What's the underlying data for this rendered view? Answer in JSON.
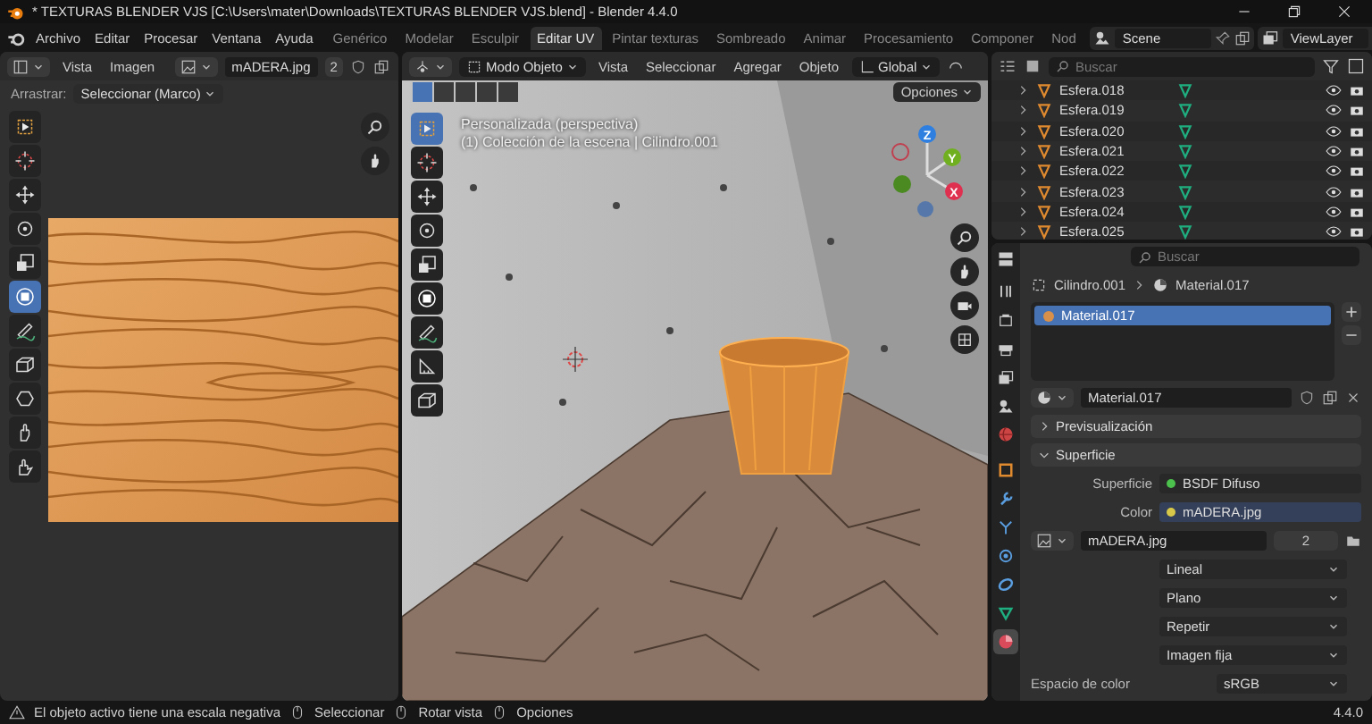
{
  "window": {
    "title": "* TEXTURAS BLENDER VJS [C:\\Users\\mater\\Downloads\\TEXTURAS BLENDER VJS.blend] - Blender 4.4.0"
  },
  "menu": [
    "Archivo",
    "Editar",
    "Procesar",
    "Ventana",
    "Ayuda"
  ],
  "workspaces": [
    {
      "label": "Genérico",
      "selected": false
    },
    {
      "label": "Modelar",
      "selected": false
    },
    {
      "label": "Esculpir",
      "selected": false
    },
    {
      "label": "Editar UV",
      "selected": true
    },
    {
      "label": "Pintar texturas",
      "selected": false
    },
    {
      "label": "Sombreado",
      "selected": false
    },
    {
      "label": "Animar",
      "selected": false
    },
    {
      "label": "Procesamiento",
      "selected": false
    },
    {
      "label": "Componer",
      "selected": false
    },
    {
      "label": "Nod",
      "selected": false
    }
  ],
  "scene": "Scene",
  "view_layer": "ViewLayer",
  "uv_editor": {
    "menu": [
      "Vista",
      "Imagen"
    ],
    "image": "mADERA.jpg",
    "users": "2",
    "drag_label": "Arrastrar:",
    "drag_mode": "Seleccionar (Marco)",
    "tools": [
      {
        "kind": "select",
        "selected": false
      },
      {
        "kind": "cursor",
        "selected": false
      },
      {
        "kind": "move",
        "selected": false
      },
      {
        "kind": "rotate",
        "selected": false
      },
      {
        "kind": "scale",
        "selected": false
      },
      {
        "kind": "transform",
        "selected": true
      },
      {
        "kind": "annotate",
        "selected": false
      },
      {
        "kind": "box",
        "selected": false
      },
      {
        "kind": "rip",
        "selected": false
      },
      {
        "kind": "grab",
        "selected": false
      },
      {
        "kind": "relax",
        "selected": false
      }
    ]
  },
  "viewport": {
    "mode": "Modo Objeto",
    "menu": [
      "Vista",
      "Seleccionar",
      "Agregar",
      "Objeto"
    ],
    "orientation": "Global",
    "options": "Opciones",
    "view_name": "Personalizada (perspectiva)",
    "collection": "(1) Colección de la escena | Cilindro.001",
    "axes": [
      "Z",
      "Y",
      "X"
    ],
    "tools": [
      {
        "kind": "select",
        "selected": true
      },
      {
        "kind": "cursor",
        "selected": false
      },
      {
        "kind": "move",
        "selected": false
      },
      {
        "kind": "rotate",
        "selected": false
      },
      {
        "kind": "scale",
        "selected": false
      },
      {
        "kind": "transform",
        "selected": false
      },
      {
        "kind": "annotate",
        "selected": false
      },
      {
        "kind": "measure",
        "selected": false
      },
      {
        "kind": "box",
        "selected": false
      }
    ]
  },
  "outliner": {
    "search_placeholder": "Buscar",
    "rows": [
      {
        "name": "Esfera.018"
      },
      {
        "name": "Esfera.019"
      },
      {
        "name": "Esfera.020"
      },
      {
        "name": "Esfera.021"
      },
      {
        "name": "Esfera.022"
      },
      {
        "name": "Esfera.023"
      },
      {
        "name": "Esfera.024"
      },
      {
        "name": "Esfera.025"
      }
    ]
  },
  "properties": {
    "search_placeholder": "Buscar",
    "tabs": [
      {
        "kind": "tool",
        "selected": false
      },
      {
        "kind": "render",
        "selected": false
      },
      {
        "kind": "output",
        "selected": false
      },
      {
        "kind": "view_layer",
        "selected": false
      },
      {
        "kind": "scene",
        "selected": false
      },
      {
        "kind": "world",
        "selected": false
      },
      {
        "kind": "object",
        "selected": false
      },
      {
        "kind": "modifier",
        "selected": false
      },
      {
        "kind": "particles",
        "selected": false
      },
      {
        "kind": "physics",
        "selected": false
      },
      {
        "kind": "constraints",
        "selected": false
      },
      {
        "kind": "data",
        "selected": false
      },
      {
        "kind": "material",
        "selected": true
      }
    ],
    "object": "Cilindro.001",
    "material": "Material.017",
    "slots": [
      {
        "name": "Material.017",
        "selected": true
      }
    ],
    "material_field": "Material.017",
    "panels": [
      {
        "title": "Previsualización",
        "expanded": false
      },
      {
        "title": "Superficie",
        "expanded": true
      }
    ],
    "surface_label": "Superficie",
    "surface": "BSDF Difuso",
    "color_label": "Color",
    "color_texture": "mADERA.jpg",
    "image": "mADERA.jpg",
    "image_users": "2",
    "dropdowns": [
      "Lineal",
      "Plano",
      "Repetir",
      "Imagen fija"
    ],
    "color_space_label": "Espacio de color",
    "color_space": "sRGB"
  },
  "status_bar": {
    "message": "El objeto activo tiene una escala negativa",
    "hints": [
      "Seleccionar",
      "Rotar vista",
      "Opciones"
    ],
    "version": "4.4.0"
  }
}
